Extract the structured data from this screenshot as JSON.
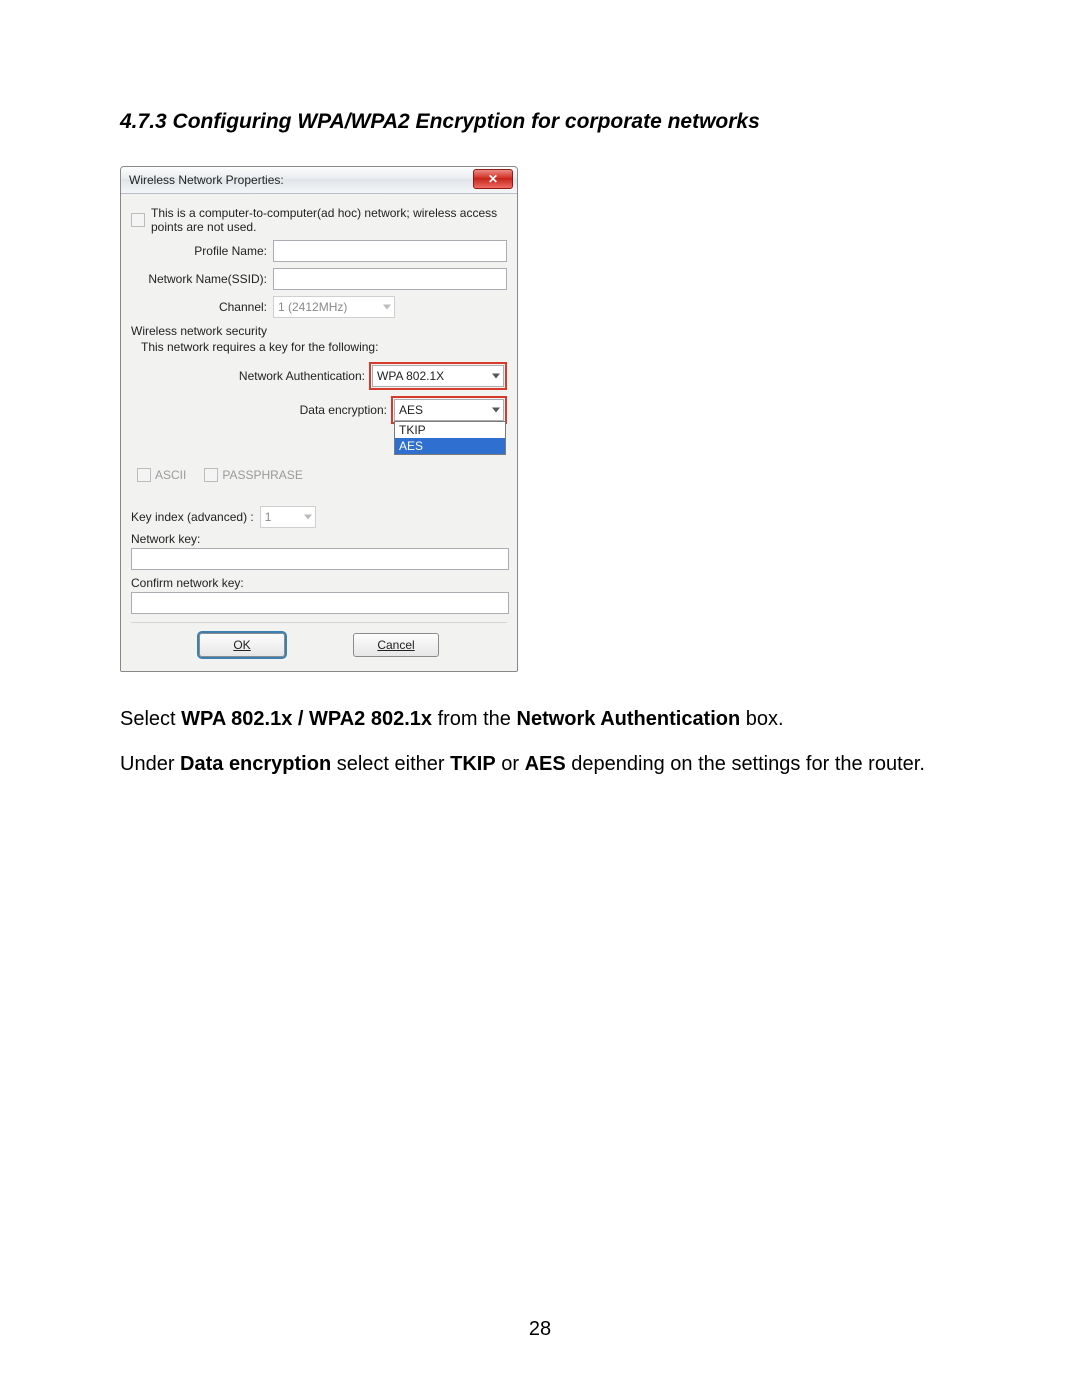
{
  "heading": "4.7.3 Configuring WPA/WPA2 Encryption for corporate networks",
  "dialog": {
    "title": "Wireless Network Properties:",
    "adhoc_checkbox": {
      "checked": false,
      "label": "This is a computer-to-computer(ad hoc) network; wireless access points are not used."
    },
    "fields": {
      "profile_name": {
        "label": "Profile Name:",
        "value": ""
      },
      "ssid": {
        "label": "Network Name(SSID):",
        "value": ""
      },
      "channel": {
        "label": "Channel:",
        "value": "1 (2412MHz)",
        "disabled": true
      }
    },
    "security": {
      "group_label": "Wireless network security",
      "requires_key_text": "This network requires a key for the following:",
      "network_authentication": {
        "label": "Network Authentication:",
        "value": "WPA 802.1X"
      },
      "data_encryption": {
        "label": "Data encryption:",
        "value": "AES",
        "options": [
          "TKIP",
          "AES"
        ],
        "selected": "AES"
      },
      "ascii": {
        "label": "ASCII",
        "checked": false,
        "disabled": true
      },
      "passphrase": {
        "label": "PASSPHRASE",
        "checked": false,
        "disabled": true
      }
    },
    "key": {
      "key_index": {
        "label": "Key index (advanced) :",
        "value": "1",
        "disabled": true
      },
      "network_key": {
        "label": "Network key:",
        "value": ""
      },
      "confirm_key": {
        "label": "Confirm network key:",
        "value": ""
      }
    },
    "buttons": {
      "ok": "OK",
      "cancel": "Cancel"
    }
  },
  "instructions": {
    "p1": {
      "pre": "Select ",
      "bold1": "WPA 802.1x / WPA2 802.1x",
      "mid": " from the ",
      "bold2": "Network Authentication",
      "post": " box."
    },
    "p2": {
      "pre": "Under ",
      "bold1": "Data encryption",
      "mid1": " select either ",
      "bold2": "TKIP",
      "mid2": " or ",
      "bold3": "AES",
      "post": " depending on the settings for the router."
    }
  },
  "page_number": "28"
}
